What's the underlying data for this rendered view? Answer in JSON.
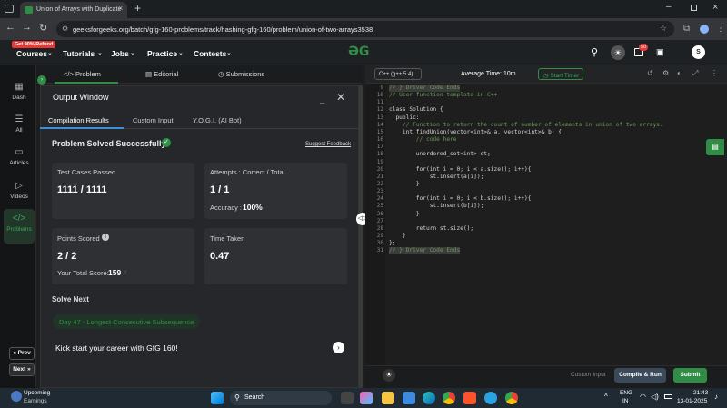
{
  "browser": {
    "tab_title": "Union of Arrays with Duplicate",
    "url": "geeksforgeeks.org/batch/gfg-160-problems/track/hashing-gfg-160/problem/union-of-two-arrays3538"
  },
  "nav": {
    "badge": "Get 90% Refund",
    "items": [
      "Courses",
      "Tutorials",
      "Jobs",
      "Practice",
      "Contests"
    ],
    "notif_count": "50",
    "avatar": "S"
  },
  "subtabs": [
    "Problem",
    "Editorial",
    "Submissions"
  ],
  "sidebar": [
    {
      "label": "Dash",
      "icon": "dashboard-icon"
    },
    {
      "label": "All",
      "icon": "list-icon"
    },
    {
      "label": "Articles",
      "icon": "article-icon"
    },
    {
      "label": "Videos",
      "icon": "video-icon"
    },
    {
      "label": "Problems",
      "icon": "code-icon"
    }
  ],
  "sidebar_prev": "« Prev",
  "sidebar_next": "Next »",
  "output": {
    "title": "Output Window",
    "tabs": [
      "Compilation Results",
      "Custom Input",
      "Y.O.G.I. (AI Bot)"
    ],
    "status": "Problem Solved Successfully",
    "feedback": "Suggest Feedback",
    "test_cases_label": "Test Cases Passed",
    "test_cases_value": "1111 / 1111",
    "attempts_label": "Attempts : Correct / Total",
    "attempts_value": "1 / 1",
    "accuracy_label": "Accuracy :",
    "accuracy_value": "100%",
    "points_label": "Points Scored",
    "points_value": "2 / 2",
    "total_score_label": "Your Total Score:",
    "total_score_value": "159",
    "time_label": "Time Taken",
    "time_value": "0.47",
    "solve_next": "Solve Next",
    "next_problem": "Day 47 - Longest Consecutive Subsequence",
    "kickstart": "Kick start your career with GfG 160!"
  },
  "editor": {
    "language": "C++ (g++ 5.4)",
    "avg_time": "Average Time: 10m",
    "timer": "Start Timer",
    "lines": [
      {
        "n": "9",
        "t": "// } Driver Code Ends",
        "c": "#6a9955",
        "hl": true
      },
      {
        "n": "10",
        "t": "// User function template in C++",
        "c": "#6a9955"
      },
      {
        "n": "11",
        "t": "",
        "c": "#ccc"
      },
      {
        "n": "12",
        "t": "class Solution {",
        "c": "#d4d4d4"
      },
      {
        "n": "13",
        "t": "  public:",
        "c": "#d4d4d4"
      },
      {
        "n": "14",
        "t": "    // Function to return the count of number of elements in union of two arrays.",
        "c": "#6a9955"
      },
      {
        "n": "15",
        "t": "    int findUnion(vector<int>& a, vector<int>& b) {",
        "c": "#d4d4d4"
      },
      {
        "n": "16",
        "t": "        // code here",
        "c": "#6a9955"
      },
      {
        "n": "17",
        "t": "",
        "c": "#ccc"
      },
      {
        "n": "18",
        "t": "        unordered_set<int> st;",
        "c": "#d4d4d4"
      },
      {
        "n": "19",
        "t": "",
        "c": "#ccc"
      },
      {
        "n": "20",
        "t": "        for(int i = 0; i < a.size(); i++){",
        "c": "#d4d4d4"
      },
      {
        "n": "21",
        "t": "            st.insert(a[i]);",
        "c": "#d4d4d4"
      },
      {
        "n": "22",
        "t": "        }",
        "c": "#d4d4d4"
      },
      {
        "n": "23",
        "t": "",
        "c": "#ccc"
      },
      {
        "n": "24",
        "t": "        for(int i = 0; i < b.size(); i++){",
        "c": "#d4d4d4"
      },
      {
        "n": "25",
        "t": "            st.insert(b[i]);",
        "c": "#d4d4d4"
      },
      {
        "n": "26",
        "t": "        }",
        "c": "#d4d4d4"
      },
      {
        "n": "27",
        "t": "",
        "c": "#ccc"
      },
      {
        "n": "28",
        "t": "        return st.size();",
        "c": "#d4d4d4"
      },
      {
        "n": "29",
        "t": "    }",
        "c": "#d4d4d4"
      },
      {
        "n": "30",
        "t": "};",
        "c": "#d4d4d4"
      },
      {
        "n": "31",
        "t": "// } Driver Code Ends",
        "c": "#6a9955",
        "hl": true
      }
    ],
    "custom_input": "Custom Input",
    "compile_run": "Compile & Run",
    "submit": "Submit"
  },
  "taskbar": {
    "weather_title": "Upcoming",
    "weather_sub": "Earnings",
    "search": "Search",
    "lang": "ENG",
    "region": "IN",
    "time": "21:43",
    "date": "13-01-2025"
  }
}
